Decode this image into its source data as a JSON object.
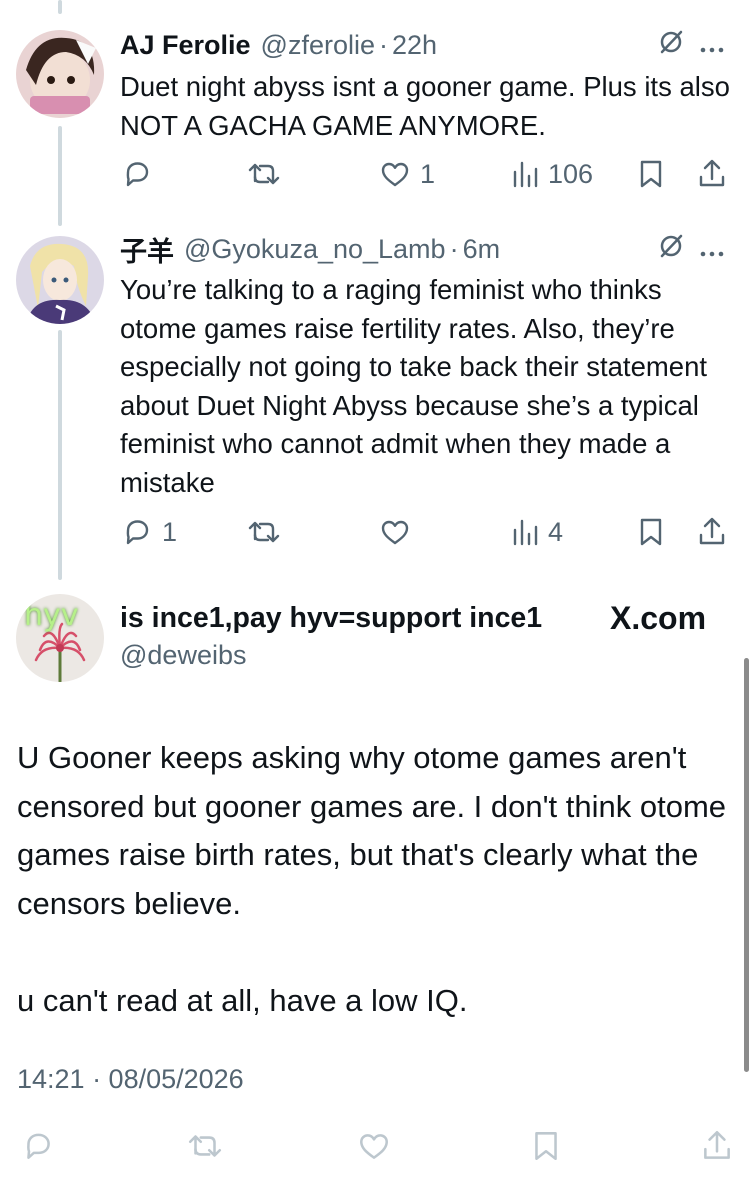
{
  "thread": [
    {
      "author_name": "AJ Ferolie",
      "handle": "@zferolie",
      "time": "22h",
      "text": "Duet night abyss isnt a gooner game. Plus its also NOT A GACHA GAME ANYMORE.",
      "replies": "",
      "retweets": "",
      "likes": "1",
      "views": "106"
    },
    {
      "author_name": "子羊",
      "handle": "@Gyokuza_no_Lamb",
      "time": "6m",
      "text": "You’re talking to a raging feminist who thinks otome games raise fertility rates. Also, they’re especially not going to take back their statement about Duet Night Abyss because she’s a typical feminist who cannot admit when they made a mistake",
      "replies": "1",
      "retweets": "",
      "likes": "",
      "views": "4"
    }
  ],
  "main_post": {
    "author_name": "is ince1,pay hyv=support ince1",
    "handle": "@deweibs",
    "avatar_text": "hyv",
    "source": "X.com",
    "paragraph_1": "U Gooner keeps asking why otome games aren't censored but gooner games are. I don't think otome games raise birth rates, but that's clearly what the censors believe.",
    "paragraph_2": "u can't read at all,  have a low IQ.",
    "timestamp": "14:21 · 08/05/2026"
  },
  "icons": [
    "reply-icon",
    "retweet-icon",
    "like-icon",
    "views-icon",
    "bookmark-icon",
    "share-icon",
    "grok-icon",
    "more-icon"
  ],
  "colors": {
    "text": "#0f1419",
    "secondary": "#536471",
    "thread_line": "#cfd9de",
    "muted_icon": "#bdc7ce"
  }
}
